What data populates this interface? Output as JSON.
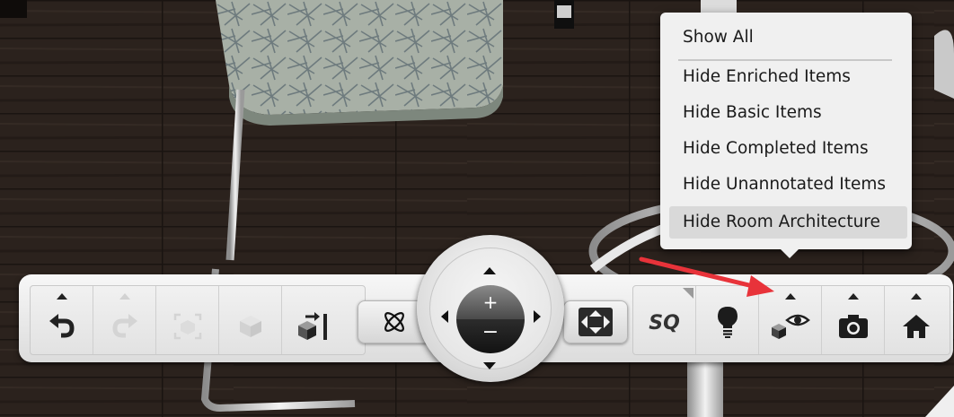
{
  "visibility_menu": {
    "show_all": "Show All",
    "items": [
      "Hide Enriched Items",
      "Hide Basic Items",
      "Hide Completed Items",
      "Hide Unannotated Items",
      "Hide Room Architecture"
    ],
    "highlighted_item": "Hide Room Architecture"
  },
  "toolbar": {
    "left_group": [
      {
        "name": "undo",
        "icon": "undo-icon",
        "enabled": true
      },
      {
        "name": "redo",
        "icon": "redo-icon",
        "enabled": false
      },
      {
        "name": "frame-selection",
        "icon": "frame-selection-icon",
        "enabled": false
      },
      {
        "name": "isolate",
        "icon": "cube-icon",
        "enabled": false
      },
      {
        "name": "export",
        "icon": "export-cube-icon",
        "enabled": true
      }
    ],
    "orbit_icon": "orbit-icon",
    "zoom": {
      "in_label": "+",
      "out_label": "−"
    },
    "fit_icon": "fit-view-icon",
    "right_group": {
      "sq_label": "SQ",
      "buttons": [
        "sq-button",
        "lightbulb-icon",
        "visibility-eye-icon",
        "camera-icon",
        "home-icon"
      ]
    }
  },
  "colors": {
    "floor": "#2a211c",
    "menu_bg": "#f0f0f0",
    "highlight": "#d9d9d9",
    "annotation_arrow": "#e8333a"
  }
}
